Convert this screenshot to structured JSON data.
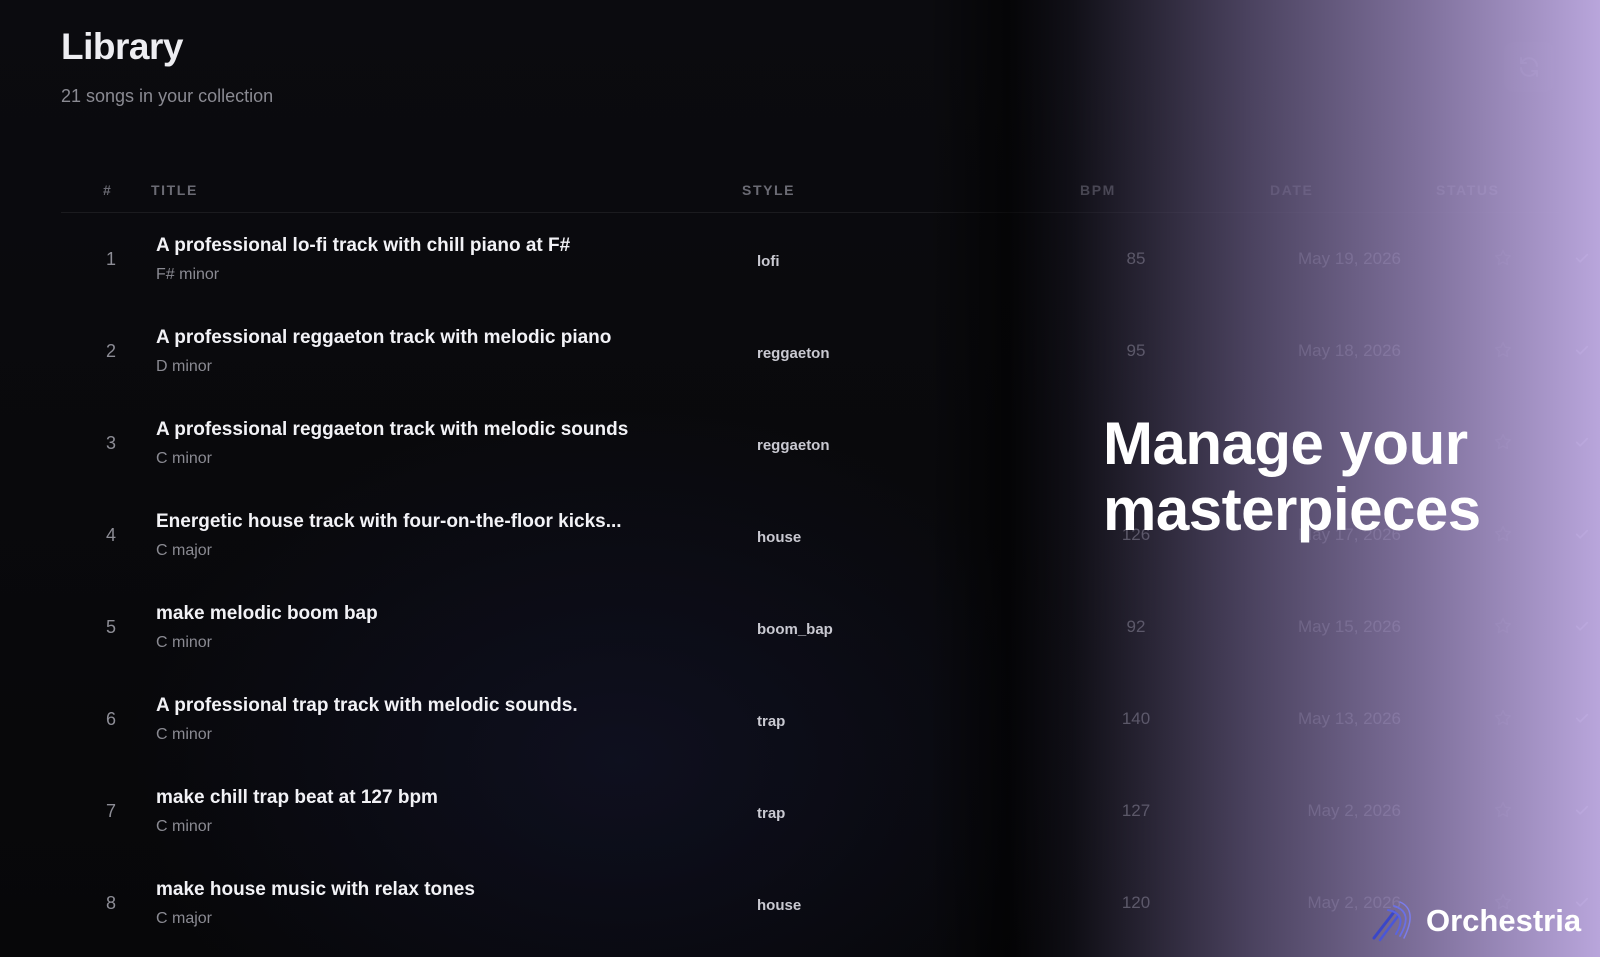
{
  "header": {
    "title": "Library",
    "subtitle": "21 songs in your collection"
  },
  "table": {
    "columns": {
      "num": "#",
      "title": "TITLE",
      "style": "STYLE",
      "bpm": "BPM",
      "date": "DATE",
      "status": "STATUS"
    },
    "rows": [
      {
        "num": "1",
        "title": "A professional lo-fi track with chill piano at F#",
        "key": "F# minor",
        "style": "lofi",
        "bpm": "85",
        "date": "May 19, 2026"
      },
      {
        "num": "2",
        "title": "A professional reggaeton track with melodic piano",
        "key": "D minor",
        "style": "reggaeton",
        "bpm": "95",
        "date": "May 18, 2026"
      },
      {
        "num": "3",
        "title": "A professional reggaeton track with melodic sounds",
        "key": "C minor",
        "style": "reggaeton",
        "bpm": "",
        "date": ""
      },
      {
        "num": "4",
        "title": "Energetic house track with four-on-the-floor kicks...",
        "key": "C major",
        "style": "house",
        "bpm": "126",
        "date": "May 17, 2026"
      },
      {
        "num": "5",
        "title": "make melodic boom bap",
        "key": "C minor",
        "style": "boom_bap",
        "bpm": "92",
        "date": "May 15, 2026"
      },
      {
        "num": "6",
        "title": "A professional trap track with melodic sounds.",
        "key": "C minor",
        "style": "trap",
        "bpm": "140",
        "date": "May 13, 2026"
      },
      {
        "num": "7",
        "title": "make chill trap beat at 127 bpm",
        "key": "C minor",
        "style": "trap",
        "bpm": "127",
        "date": "May 2, 2026"
      },
      {
        "num": "8",
        "title": "make house music with relax tones",
        "key": "C major",
        "style": "house",
        "bpm": "120",
        "date": "May 2, 2026"
      }
    ]
  },
  "promo": {
    "line1": "Manage your",
    "line2": "masterpieces"
  },
  "brand": {
    "name": "Orchestria"
  },
  "icons": {
    "refresh": "refresh-icon",
    "favorite": "star-icon",
    "status": "check-icon",
    "logo": "orchestria-logo-icon"
  },
  "colors": {
    "background": "#070709",
    "accent_purple": "#c0ace4",
    "text_primary": "#f2f2f6",
    "text_muted": "#8a8a92"
  }
}
